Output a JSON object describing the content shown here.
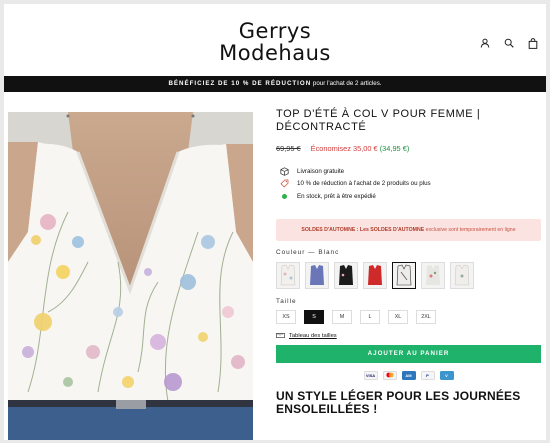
{
  "header": {
    "logo_line1": "Gerrys",
    "logo_line2": "Modehaus",
    "icons": [
      "account-icon",
      "search-icon",
      "cart-icon"
    ]
  },
  "announcement": {
    "bold": "BÉNÉFICIEZ DE 10 % DE RÉDUCTION",
    "rest": " pour l'achat de 2 articles."
  },
  "product": {
    "title": "TOP D'ÉTÉ À COL V POUR FEMME | DÉCONTRACTÉ",
    "old_price": "69,95 €",
    "savings_prefix": "Économisez 35,00 €",
    "new_price": "(34,95 €)",
    "features": [
      {
        "icon": "package-icon",
        "text": "Livraison gratuite"
      },
      {
        "icon": "tag-icon",
        "text": "10 % de réduction à l'achat de 2 produits ou plus"
      },
      {
        "icon": "in-stock-dot",
        "text": "En stock, prêt à être expédié"
      }
    ],
    "promo_bold": "SOLDES D'AUTOMNE : Les SOLDES D'AUTOMNE",
    "promo_rest": " exclusive sont temporairement en ligne",
    "color_label": "Couleur — Blanc",
    "sizes_label": "Taille",
    "sizes": [
      "XS",
      "S",
      "M",
      "L",
      "XL",
      "2XL"
    ],
    "selected_size": "S",
    "size_chart": "Tableau des tailles",
    "add_to_cart": "AJOUTER AU PANIER",
    "payments": [
      "VISA",
      "mastercard",
      "amex",
      "PayPal",
      "venmo"
    ],
    "tagline": "UN STYLE LÉGER POUR LES JOURNÉES ENSOLEILLÉES !"
  },
  "colors": {
    "accent_green": "#1fb26a",
    "sale_red": "#d23c3c",
    "price_green": "#1a8f3c",
    "promo_bg": "#fbe3e1",
    "swatches": [
      "#f2f0ec",
      "#6b76b8",
      "#1b1b1b",
      "#cf2a2a",
      "#eeecea",
      "#e8e6e2",
      "#f0eeeb"
    ]
  }
}
